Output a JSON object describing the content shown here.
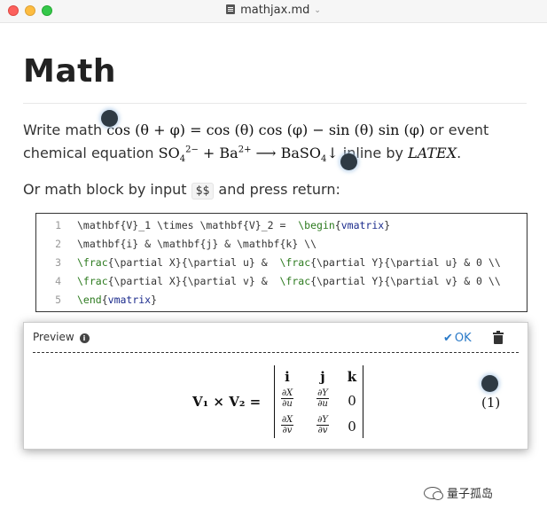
{
  "window": {
    "title": "mathjax.md"
  },
  "doc": {
    "heading": "Math",
    "para1": {
      "text_a": "Write math ",
      "inline_math": "cos (θ + φ) = cos (θ) cos (φ) − sin (θ) sin (φ)",
      "text_b": " or event"
    },
    "para2": {
      "text_a": "chemical equation ",
      "chem_a": "SO",
      "chem_a_sub": "4",
      "chem_a_sup": "2−",
      "chem_b": " + Ba",
      "chem_b_sup": "2+",
      "chem_c": " ⟶ BaSO",
      "chem_c_sub": "4",
      "chem_d": "↓",
      "text_b": " inline by ",
      "latex_logo": "LATEX",
      "text_c": "."
    },
    "para3": {
      "text_a": "Or math block by input ",
      "code": "$$",
      "text_b": " and press return:"
    }
  },
  "editor": {
    "lines": [
      {
        "num": "1",
        "parts": [
          [
            "p",
            "\\mathbf{V}_1 \\times \\mathbf{V}_2 =  "
          ],
          [
            "k",
            "\\begin"
          ],
          [
            "p",
            "{"
          ],
          [
            "n",
            "vmatrix"
          ],
          [
            "p",
            "}"
          ]
        ]
      },
      {
        "num": "2",
        "parts": [
          [
            "p",
            "\\mathbf{i} & \\mathbf{j} & \\mathbf{k} \\\\"
          ]
        ]
      },
      {
        "num": "3",
        "parts": [
          [
            "k",
            "\\frac"
          ],
          [
            "p",
            "{\\partial X}{\\partial u} &  "
          ],
          [
            "k",
            "\\frac"
          ],
          [
            "p",
            "{\\partial Y}{\\partial u} & 0 \\\\"
          ]
        ]
      },
      {
        "num": "4",
        "parts": [
          [
            "k",
            "\\frac"
          ],
          [
            "p",
            "{\\partial X}{\\partial v} &  "
          ],
          [
            "k",
            "\\frac"
          ],
          [
            "p",
            "{\\partial Y}{\\partial v} & 0 \\\\"
          ]
        ]
      },
      {
        "num": "5",
        "parts": [
          [
            "k",
            "\\end"
          ],
          [
            "p",
            "{"
          ],
          [
            "n",
            "vmatrix"
          ],
          [
            "p",
            "}"
          ]
        ]
      }
    ]
  },
  "preview": {
    "label": "Preview",
    "ok_label": "OK",
    "equation": {
      "lhs": "V₁ × V₂ =",
      "matrix": {
        "row1": [
          "i",
          "j",
          "k"
        ],
        "row2": [
          {
            "num": "∂X",
            "den": "∂u"
          },
          {
            "num": "∂Y",
            "den": "∂u"
          },
          "0"
        ],
        "row3": [
          {
            "num": "∂X",
            "den": "∂v"
          },
          {
            "num": "∂Y",
            "den": "∂v"
          },
          "0"
        ]
      },
      "number": "(1)"
    }
  },
  "watermark": {
    "text": "量子孤岛"
  },
  "colors": {
    "keyword": "#2c7a1e",
    "name": "#1b2b8c",
    "ok": "#2a7ac8"
  }
}
